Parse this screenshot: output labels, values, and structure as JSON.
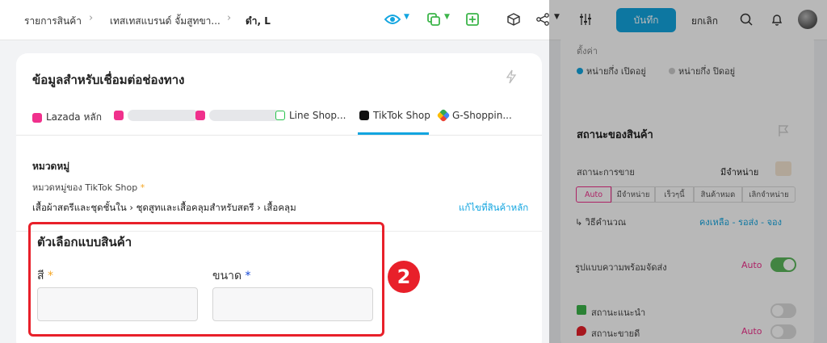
{
  "breadcrumb": {
    "item1": "รายการสินค้า",
    "item2": "เทสเทสแบรนด์ จั้มสูทขา...",
    "item3": "ดำ, L",
    "separator": "›"
  },
  "toolbar": {
    "save_label": "บันทึก",
    "cancel_label": "ยกเลิก"
  },
  "card": {
    "title": "ข้อมูลสำหรับเชื่อมต่อช่องทาง"
  },
  "tabs": [
    {
      "label": "Lazada หลัก",
      "icon": "lazada-icon"
    },
    {
      "label": "",
      "icon": "lazada-icon"
    },
    {
      "label": "",
      "icon": "lazada-icon"
    },
    {
      "label": "Line Shop...",
      "icon": "line-shop-icon"
    },
    {
      "label": "TikTok Shop",
      "icon": "tiktok-icon"
    },
    {
      "label": "G-Shoppin...",
      "icon": "google-shopping-icon"
    }
  ],
  "category": {
    "section_label": "หมวดหมู่",
    "sub_label": "หมวดหมู่ของ TikTok Shop",
    "required_mark": "*",
    "path": "เสื้อผ้าสตรีและชุดชั้นใน › ชุดสูทและเสื้อคลุมสำหรับสตรี › เสื้อคลุม",
    "edit_link": "แก้ไขที่สินค้าหลัก"
  },
  "options": {
    "title": "ตัวเลือกแบบสินค้า",
    "color_label": "สี",
    "size_label": "ขนาด",
    "required_mark": "*",
    "color_value": "",
    "size_value": ""
  },
  "annotation": {
    "step": "2"
  },
  "right": {
    "top_label": "ตั้งค่า",
    "radio1": "หน่ายกึ่ง เปิดอยู่",
    "radio2": "หน่ายกึ่ง ปิดอยู่",
    "status_title": "สถานะของสินค้า",
    "sale_status_label": "สถานะการขาย",
    "sale_status_value": "มีจำหน่าย",
    "chips": [
      "Auto",
      "มีจำหน่าย",
      "เร็วๆนี้",
      "สินค้าหมด",
      "เลิกจำหน่าย"
    ],
    "calc_label": "วิธีคำนวณ",
    "calc_value": "คงเหลือ - รอส่ง - จอง",
    "ship_label": "รูปแบบความพร้อมจัดส่ง",
    "ship_value": "Auto",
    "recommend_label": "สถานะแนะนำ",
    "bestseller_label": "สถานะขายดี",
    "bestseller_value": "Auto"
  },
  "colors": {
    "accent": "#12a5e0",
    "annotation": "#e8202a",
    "required": "#f5a623",
    "toggle_on": "#5cb85c"
  }
}
